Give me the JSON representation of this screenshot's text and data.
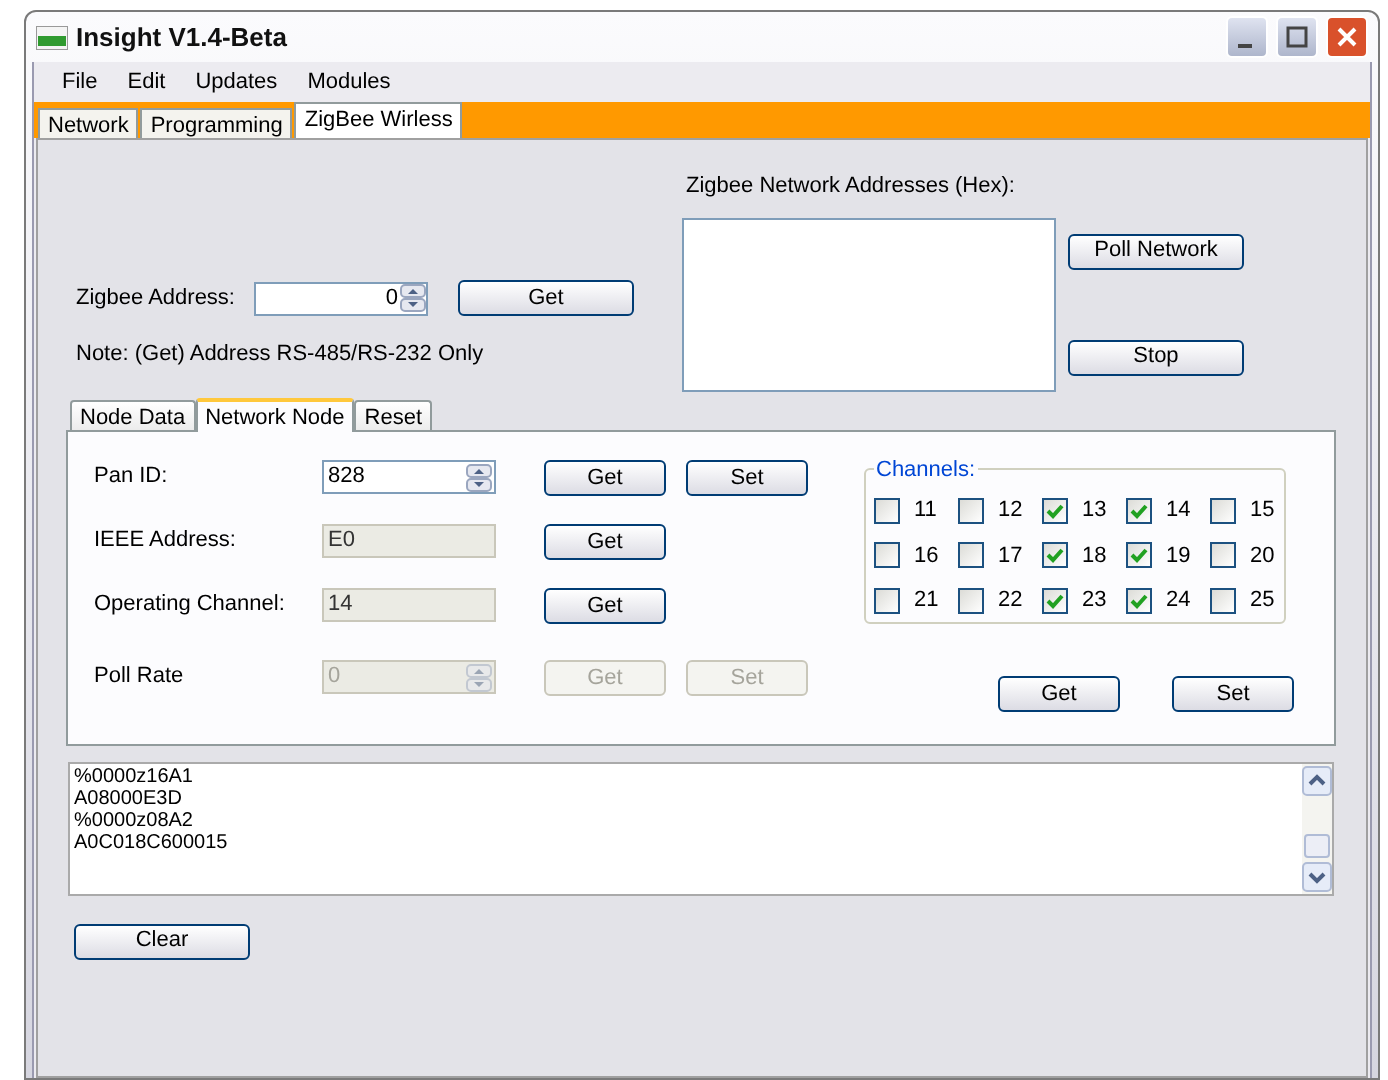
{
  "window": {
    "title": "Insight V1.4-Beta"
  },
  "menu": [
    {
      "label": "File"
    },
    {
      "label": "Edit"
    },
    {
      "label": "Updates"
    },
    {
      "label": "Modules"
    }
  ],
  "tabs": [
    {
      "label": "Network",
      "selected": false
    },
    {
      "label": "Programming",
      "selected": false
    },
    {
      "label": "ZigBee Wirless",
      "selected": true
    }
  ],
  "zigbee_address": {
    "label": "Zigbee Address:",
    "value": "0",
    "button": "Get",
    "note": "Note: (Get) Address RS-485/RS-232 Only"
  },
  "network_addresses": {
    "label": "Zigbee Network Addresses (Hex):",
    "buttons": [
      "Poll Network",
      "Stop"
    ]
  },
  "node_tabs": [
    {
      "label": "Node Data",
      "selected": false
    },
    {
      "label": "Network Node",
      "selected": true
    },
    {
      "label": "Reset",
      "selected": false
    }
  ],
  "fields": [
    {
      "label": "Pan ID:",
      "value": "828",
      "kind": "spin",
      "disabled": false,
      "buttons": [
        {
          "label": "Get",
          "disabled": false
        },
        {
          "label": "Set",
          "disabled": false
        }
      ]
    },
    {
      "label": "IEEE Address:",
      "value": "E0",
      "kind": "readonly",
      "disabled": false,
      "buttons": [
        {
          "label": "Get",
          "disabled": false
        }
      ]
    },
    {
      "label": "Operating Channel:",
      "value": "14",
      "kind": "readonly",
      "disabled": false,
      "buttons": [
        {
          "label": "Get",
          "disabled": false
        }
      ]
    },
    {
      "label": "Poll Rate",
      "value": "0",
      "kind": "spin",
      "disabled": true,
      "buttons": [
        {
          "label": "Get",
          "disabled": true
        },
        {
          "label": "Set",
          "disabled": true
        }
      ]
    }
  ],
  "channels": {
    "title": "Channels:",
    "items": [
      {
        "label": "11",
        "checked": false
      },
      {
        "label": "12",
        "checked": false
      },
      {
        "label": "13",
        "checked": true
      },
      {
        "label": "14",
        "checked": true
      },
      {
        "label": "15",
        "checked": false
      },
      {
        "label": "16",
        "checked": false
      },
      {
        "label": "17",
        "checked": false
      },
      {
        "label": "18",
        "checked": true
      },
      {
        "label": "19",
        "checked": true
      },
      {
        "label": "20",
        "checked": false
      },
      {
        "label": "21",
        "checked": false
      },
      {
        "label": "22",
        "checked": false
      },
      {
        "label": "23",
        "checked": true
      },
      {
        "label": "24",
        "checked": true
      },
      {
        "label": "25",
        "checked": false
      }
    ],
    "buttons": [
      "Get",
      "Set"
    ]
  },
  "log": {
    "lines": [
      "%0000z16A1",
      "A08000E3D",
      "%0000z08A2",
      "A0C018C600015"
    ]
  },
  "clear_button": "Clear"
}
